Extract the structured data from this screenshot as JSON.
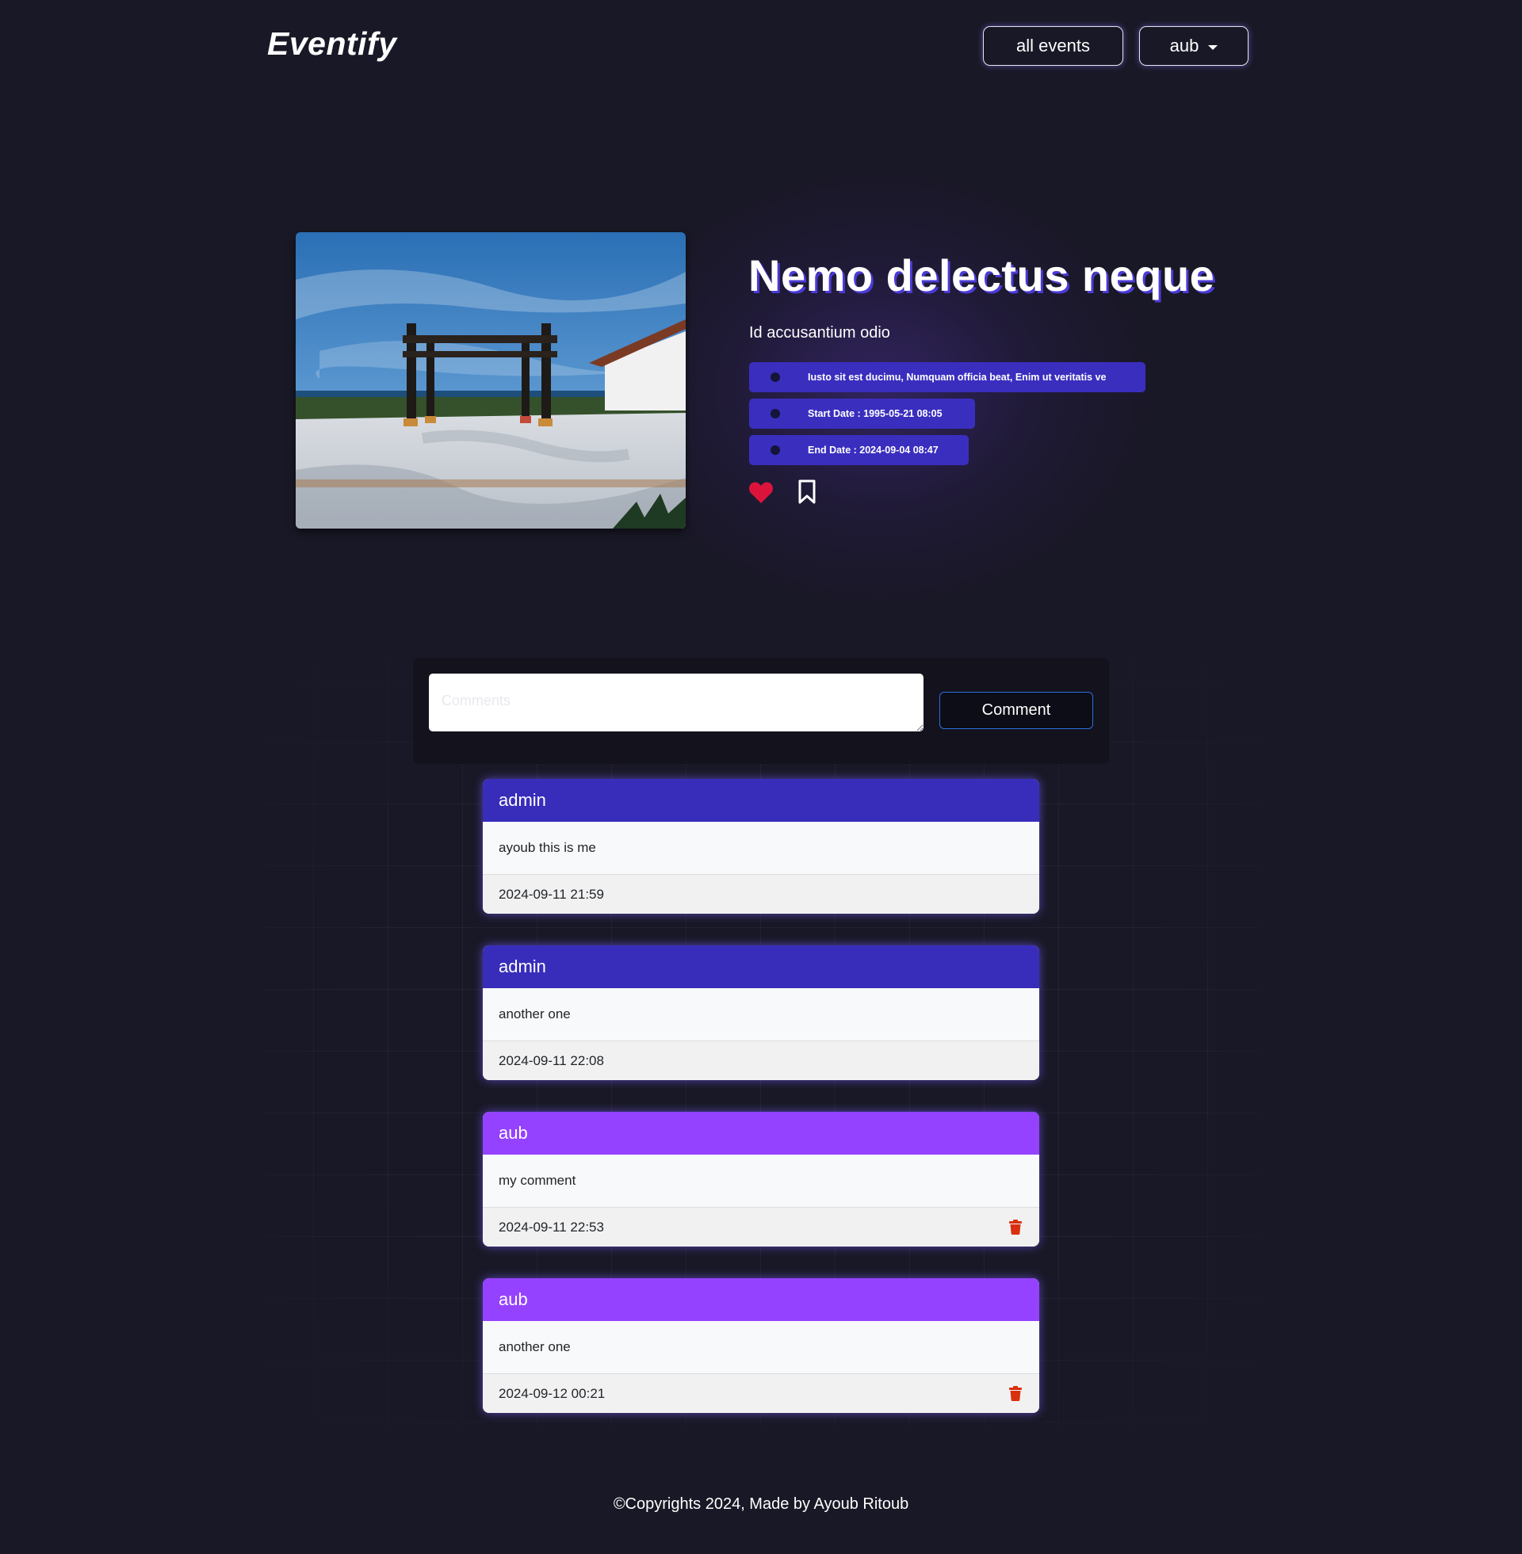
{
  "header": {
    "brand": "Eventify",
    "all_events_label": "all events",
    "user_menu_label": "aub"
  },
  "event": {
    "title": "Nemo delectus neque",
    "subtitle": "Id accusantium odio",
    "description": "Iusto sit est ducimu, Numquam officia beat, Enim ut veritatis ve",
    "start_date": "Start Date : 1995-05-21 08:05",
    "end_date": "End Date : 2024-09-04 08:47",
    "like_icon": "heart-icon",
    "bookmark_icon": "bookmark-icon"
  },
  "comment_form": {
    "placeholder": "Comments",
    "submit_label": "Comment"
  },
  "comments": [
    {
      "author": "admin",
      "text": "ayoub this is me",
      "date": "2024-09-11 21:59",
      "own": false
    },
    {
      "author": "admin",
      "text": "another one",
      "date": "2024-09-11 22:08",
      "own": false
    },
    {
      "author": "aub",
      "text": "my comment",
      "date": "2024-09-11 22:53",
      "own": true
    },
    {
      "author": "aub",
      "text": "another one",
      "date": "2024-09-12 00:21",
      "own": true
    }
  ],
  "footer": {
    "text": "©Copyrights 2024, Made by Ayoub Ritoub"
  },
  "colors": {
    "background": "#191826",
    "accent_pill": "#3a2ebf",
    "admin_header": "#382dbb",
    "own_header": "#9442ff",
    "like": "#dc143c",
    "delete": "#d9300f"
  }
}
